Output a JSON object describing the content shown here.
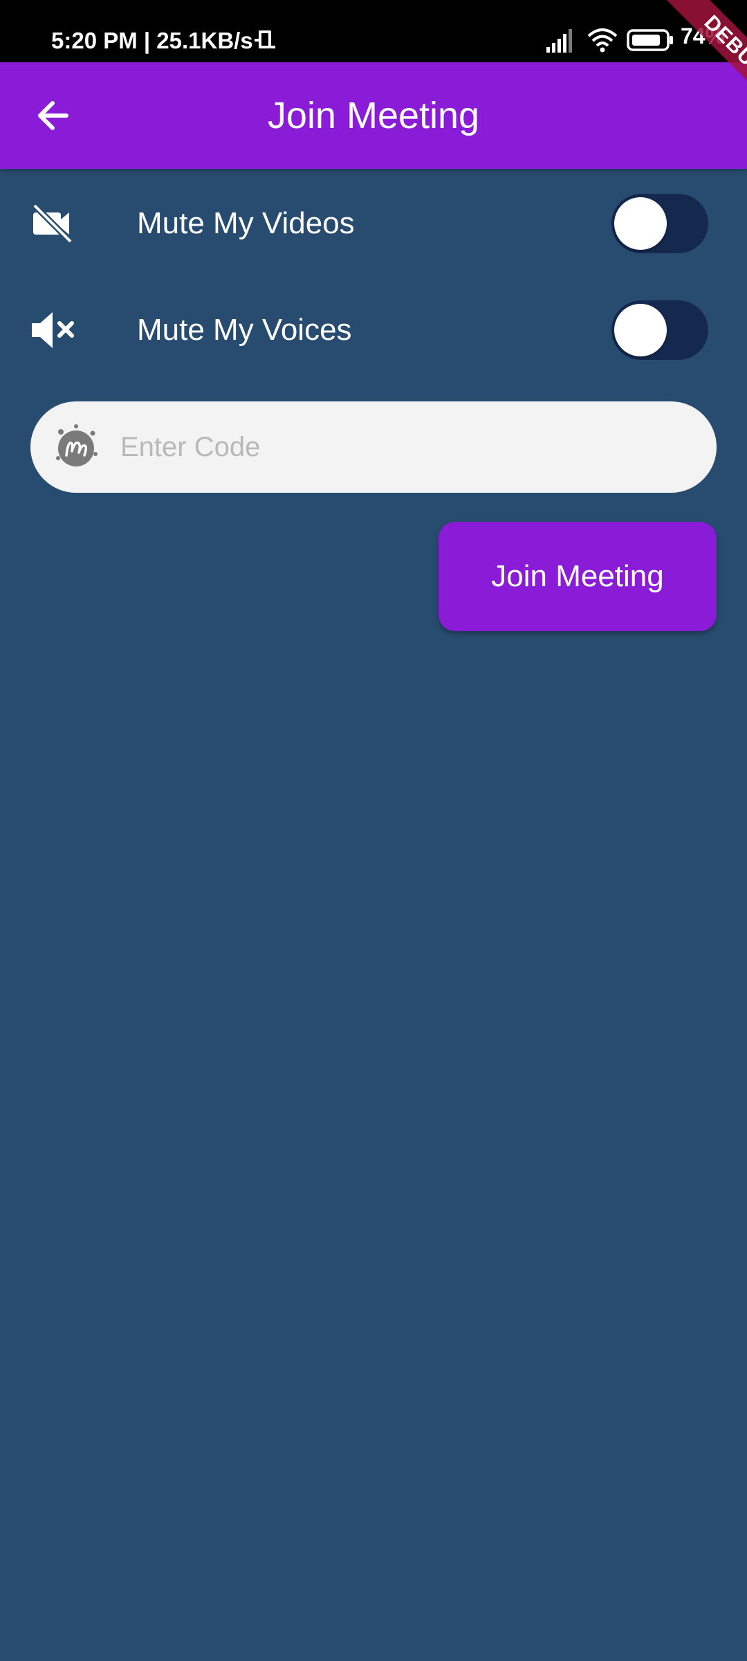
{
  "status_bar": {
    "time_speed": "5:20 PM | 25.1KB/s",
    "battery_level": "74%",
    "icons": [
      "network-activity-icon",
      "signal-icon",
      "wifi-icon",
      "battery-icon"
    ]
  },
  "debug_banner": {
    "label": "DEBUG"
  },
  "app_bar": {
    "title": "Join Meeting",
    "back_icon": "arrow-back-icon",
    "color": "#8a1bd6"
  },
  "settings": [
    {
      "icon": "video-off-icon",
      "label": "Mute My Videos",
      "enabled": false
    },
    {
      "icon": "volume-off-icon",
      "label": "Mute My Voices",
      "enabled": false
    }
  ],
  "code_field": {
    "icon": "meetup-logo-icon",
    "value": "",
    "placeholder": "Enter Code"
  },
  "join_button": {
    "label": "Join Meeting",
    "color": "#8a1bd6"
  },
  "colors": {
    "background": "#284c70",
    "toggle_track": "#15294f"
  }
}
